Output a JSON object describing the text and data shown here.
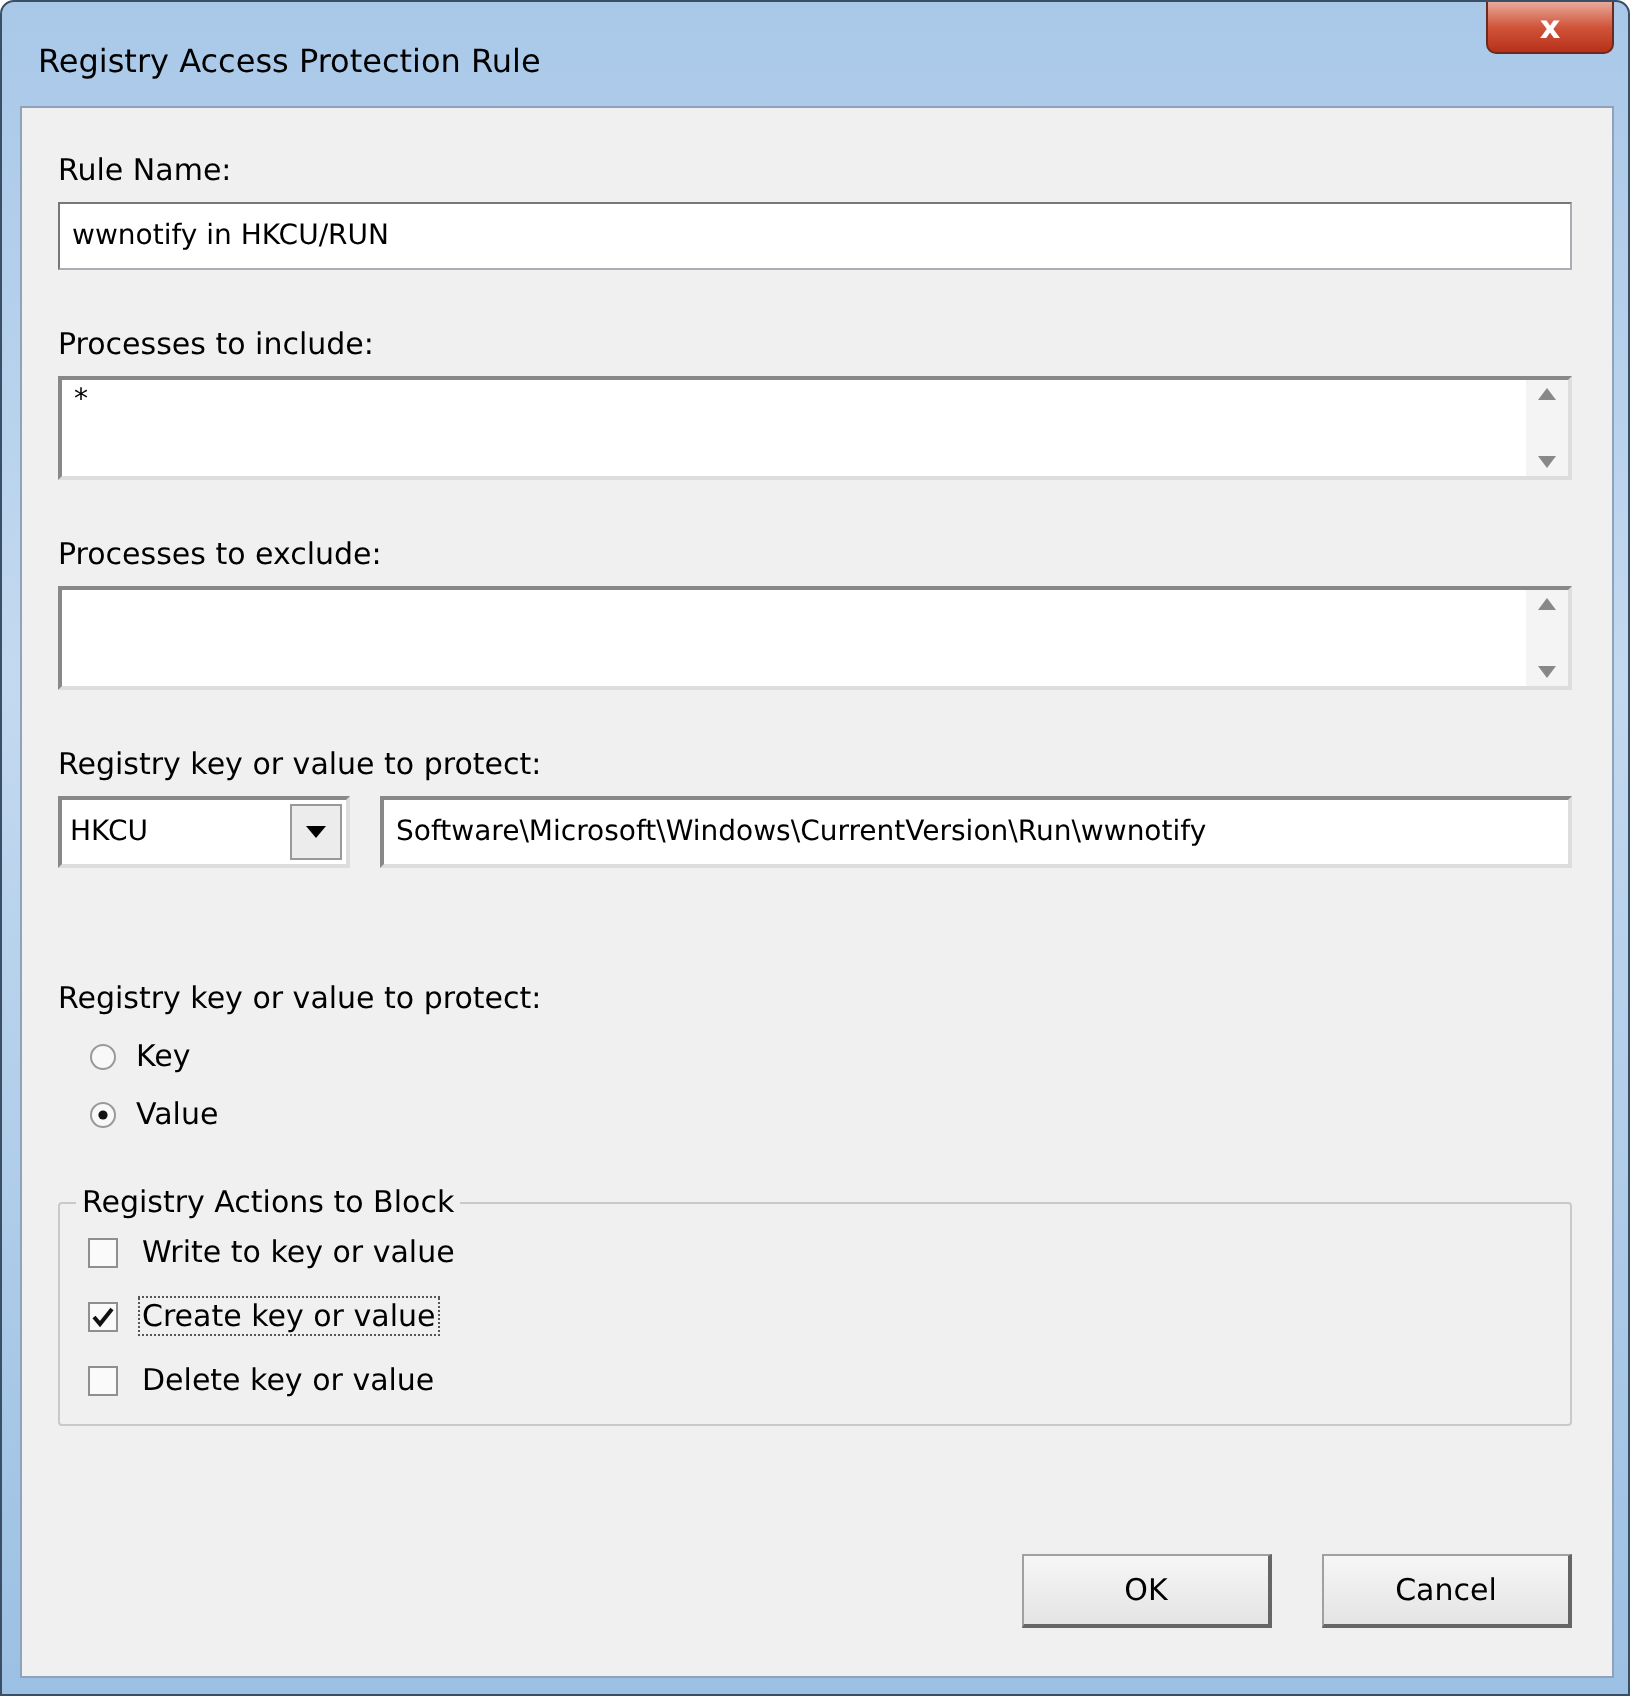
{
  "window": {
    "title": "Registry Access Protection Rule",
    "close": "x"
  },
  "rule_name": {
    "label": "Rule Name:",
    "value": "wwnotify in HKCU/RUN"
  },
  "processes_include": {
    "label": "Processes to include:",
    "value": "*"
  },
  "processes_exclude": {
    "label": "Processes to exclude:"
  },
  "registry_key": {
    "label": "Registry key or value to protect:",
    "root": "HKCU",
    "path": "Software\\Microsoft\\Windows\\CurrentVersion\\Run\\wwnotify"
  },
  "protect_type": {
    "label": "Registry key or value to protect:",
    "options": [
      {
        "label": "Key",
        "selected": false
      },
      {
        "label": "Value",
        "selected": true
      }
    ]
  },
  "actions": {
    "title": "Registry Actions to Block",
    "items": [
      {
        "label": "Write to key or value",
        "checked": false,
        "focused": false
      },
      {
        "label": "Create key or value",
        "checked": true,
        "focused": true
      },
      {
        "label": "Delete key or value",
        "checked": false,
        "focused": false
      }
    ]
  },
  "buttons": [
    "OK",
    "Cancel"
  ]
}
